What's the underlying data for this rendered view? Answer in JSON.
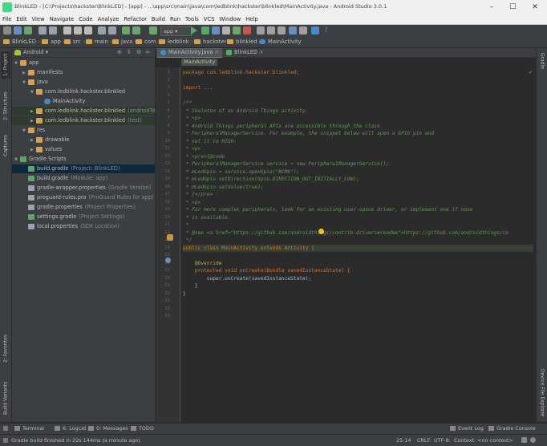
{
  "window": {
    "title": "BlinkLED - [C:\\Projects\\hackster\\BlinkLED] - [app] - ...\\app\\src\\main\\java\\com\\ledblink\\hackster\\blinkled\\MainActivity.java - Android Studio 3.0.1",
    "controls": {
      "minimize": "–",
      "maximize": "☐",
      "close": "✕"
    }
  },
  "menu": [
    "File",
    "Edit",
    "View",
    "Navigate",
    "Code",
    "Analyze",
    "Refactor",
    "Build",
    "Run",
    "Tools",
    "VCS",
    "Window",
    "Help"
  ],
  "toolbar": {
    "run_config": "app"
  },
  "navbar": {
    "crumbs": [
      "BlinkLED",
      "app",
      "src",
      "main",
      "java",
      "com",
      "ledblink",
      "hackster",
      "blinkled",
      "MainActivity"
    ]
  },
  "left_tabs": [
    "1: Project",
    "2: Structure",
    "Captures",
    "2: Favorites",
    "Build Variants"
  ],
  "right_tabs": [
    "Gradle",
    "Device File Explorer"
  ],
  "project": {
    "view_mode": "Android",
    "tree": [
      {
        "label": "app",
        "depth": 0,
        "icon": "folder-icon"
      },
      {
        "label": "manifests",
        "depth": 1,
        "icon": "folder-icon"
      },
      {
        "label": "java",
        "depth": 1,
        "icon": "folder-icon"
      },
      {
        "label": "com.ledblink.hackster.blinkled",
        "depth": 2,
        "icon": "package-icon"
      },
      {
        "label": "MainActivity",
        "depth": 3,
        "icon": "class-icon"
      },
      {
        "label": "com.ledblink.hackster.blinkled",
        "suffix": "(androidTest)",
        "depth": 2,
        "icon": "package-icon"
      },
      {
        "label": "com.ledblink.hackster.blinkled",
        "suffix": "(test)",
        "depth": 2,
        "icon": "package-icon"
      },
      {
        "label": "res",
        "depth": 1,
        "icon": "folder-icon"
      },
      {
        "label": "drawable",
        "depth": 2,
        "icon": "folder-icon"
      },
      {
        "label": "values",
        "depth": 2,
        "icon": "folder-icon"
      },
      {
        "label": "Gradle Scripts",
        "depth": 0,
        "icon": "gradle-icon"
      },
      {
        "label": "build.gradle",
        "suffix": "(Project: BlinkLED)",
        "depth": 1,
        "icon": "gradle-file-icon",
        "selected": true
      },
      {
        "label": "build.gradle",
        "suffix": "(Module: app)",
        "depth": 1,
        "icon": "gradle-file-icon"
      },
      {
        "label": "gradle-wrapper.properties",
        "suffix": "(Gradle Version)",
        "depth": 1,
        "icon": "properties-icon"
      },
      {
        "label": "proguard-rules.pro",
        "suffix": "(ProGuard Rules for app)",
        "depth": 1,
        "icon": "file-icon"
      },
      {
        "label": "gradle.properties",
        "suffix": "(Project Properties)",
        "depth": 1,
        "icon": "properties-icon"
      },
      {
        "label": "settings.gradle",
        "suffix": "(Project Settings)",
        "depth": 1,
        "icon": "gradle-file-icon"
      },
      {
        "label": "local.properties",
        "suffix": "(SDK Location)",
        "depth": 1,
        "icon": "properties-icon"
      }
    ]
  },
  "editor": {
    "tabs": [
      {
        "label": "MainActivity.java",
        "active": true
      },
      {
        "label": "BlinkLED",
        "active": false
      }
    ],
    "breadcrumb": "MainActivity",
    "line_numbers": [
      "1",
      "2",
      "3",
      "4",
      "5",
      "6",
      "7",
      "8",
      "9",
      "10",
      "11",
      "12",
      "13",
      "14",
      "15",
      "16",
      "17",
      "18",
      "19",
      "20",
      "21",
      "22",
      "23",
      "24",
      "25",
      "26",
      "27",
      "28",
      "29",
      "30",
      "31",
      "32",
      "33"
    ],
    "code_lines": [
      "package com.ledblink.hackster.blinkled;",
      "",
      "import ...",
      "",
      "/**",
      " * Skeleton of an Android Things activity.",
      " * <p>",
      " * Android Things peripheral APIs are accessible through the class",
      " * PeripheralManagerService. For example, the snippet below will open a GPIO pin and",
      " * set it to HIGH:",
      " * <p>",
      " * <pre>{@code",
      " * PeripheralManagerService service = new PeripheralManagerService();",
      " * mLedGpio = service.openGpio(\"BCM6\");",
      " * mLedGpio.setDirection(Gpio.DIRECTION_OUT_INITIALLY_LOW);",
      " * mLedGpio.setValue(true);",
      " * }</pre>",
      " * <p>",
      " * For more complex peripherals, look for an existing user-space driver, or implement one if none",
      " * is available.",
      " *",
      " * @see <a href=\"https://github.com/androidthings/contrib-drivers#readme\">https://github.com/androidthings/co",
      " */",
      "public class MainActivity extends Activity {",
      "",
      "    @Override",
      "    protected void onCreate(Bundle savedInstanceState) {",
      "        super.onCreate(savedInstanceState);",
      "    }",
      "}",
      "",
      "",
      ""
    ]
  },
  "bottom_tools": [
    "Terminal",
    "6: Logcat",
    "0: Messages",
    "TODO"
  ],
  "bottom_tools_right": [
    "Event Log",
    "Gradle Console"
  ],
  "status": {
    "message": "Gradle build finished in 22s 144ms (a minute ago)",
    "position": "25:14",
    "line_sep": "CRLF:",
    "encoding": "UTF-8:",
    "context": "Context: <no context>"
  },
  "colors": {
    "accent": "#4a88c7",
    "selection": "#0d293e",
    "keyword": "#cc7832",
    "comment": "#629755",
    "annotation": "#bbb529"
  }
}
